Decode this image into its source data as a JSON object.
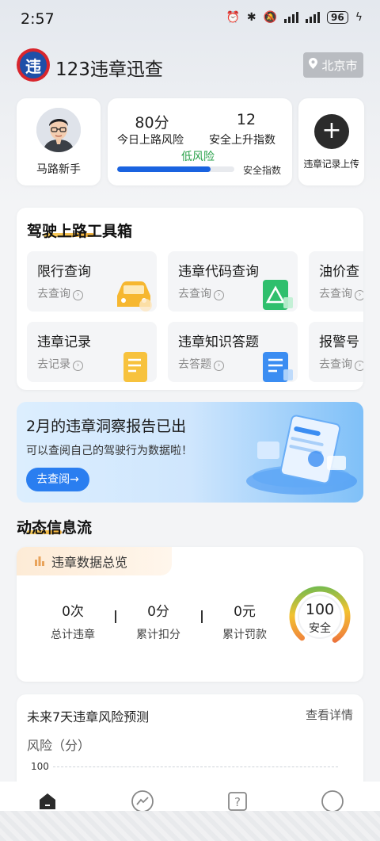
{
  "status_bar": {
    "time": "2:57",
    "battery": "96"
  },
  "header": {
    "app_title": "123违章迅查",
    "logo_text": "违",
    "city": "北京市"
  },
  "profile": {
    "name": "马路新手"
  },
  "stats": {
    "score_value": "80分",
    "score_label": "今日上路风险",
    "rise_value": "12",
    "rise_label": "安全上升指数",
    "risk_level": "低风险",
    "safety_label": "安全指数",
    "safety_progress": 0.8
  },
  "upload": {
    "label": "违章记录上传"
  },
  "toolbox": {
    "title": "驾驶上路工具箱",
    "tools": [
      {
        "name": "限行查询",
        "action": "去查询"
      },
      {
        "name": "违章代码查询",
        "action": "去查询"
      },
      {
        "name": "油价查",
        "action": "去查询"
      },
      {
        "name": "违章记录",
        "action": "去记录"
      },
      {
        "name": "违章知识答题",
        "action": "去答题"
      },
      {
        "name": "报警号",
        "action": "去查询"
      }
    ]
  },
  "banner": {
    "title": "2月的违章洞察报告已出",
    "subtitle": "可以查阅自己的驾驶行为数据啦！",
    "button": "去查阅→"
  },
  "feed": {
    "title": "动态信息流",
    "overview": {
      "tag": "违章数据总览",
      "stats": [
        {
          "value": "0次",
          "label": "总计违章"
        },
        {
          "value": "0分",
          "label": "累计扣分"
        },
        {
          "value": "0元",
          "label": "累计罚款"
        }
      ],
      "gauge_value": "100",
      "gauge_label": "安全"
    },
    "forecast": {
      "title": "未来7天违章风险预测",
      "link": "查看详情",
      "axis_label": "风险（分）",
      "tick_top": "100"
    }
  },
  "colors": {
    "accent": "#1a63e0",
    "risk_low": "#2aa14a",
    "banner_button": "#2a7ef0"
  }
}
